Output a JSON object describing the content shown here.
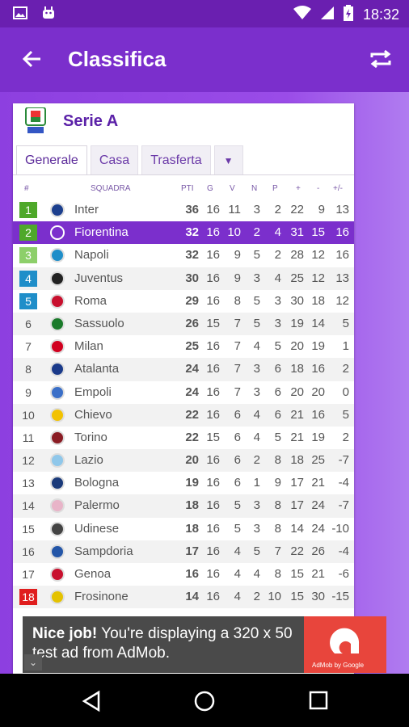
{
  "status": {
    "time": "18:32"
  },
  "appbar": {
    "title": "Classifica",
    "back_icon": "arrow-back-icon",
    "refresh_icon": "refresh-icon"
  },
  "card": {
    "league_name": "Serie A",
    "tabs": [
      "Generale",
      "Casa",
      "Trasferta"
    ],
    "dropdown": "▼"
  },
  "table": {
    "headers": {
      "pos": "#",
      "team": "SQUADRA",
      "pts": "PTI",
      "g": "G",
      "v": "V",
      "n": "N",
      "p": "P",
      "f": "+",
      "a": "-",
      "d": "+/-"
    },
    "rows": [
      {
        "pos": "1",
        "team": "Inter",
        "pts": "36",
        "g": "16",
        "v": "11",
        "n": "3",
        "p": "2",
        "f": "22",
        "a": "9",
        "d": "13"
      },
      {
        "pos": "2",
        "team": "Fiorentina",
        "pts": "32",
        "g": "16",
        "v": "10",
        "n": "2",
        "p": "4",
        "f": "31",
        "a": "15",
        "d": "16"
      },
      {
        "pos": "3",
        "team": "Napoli",
        "pts": "32",
        "g": "16",
        "v": "9",
        "n": "5",
        "p": "2",
        "f": "28",
        "a": "12",
        "d": "16"
      },
      {
        "pos": "4",
        "team": "Juventus",
        "pts": "30",
        "g": "16",
        "v": "9",
        "n": "3",
        "p": "4",
        "f": "25",
        "a": "12",
        "d": "13"
      },
      {
        "pos": "5",
        "team": "Roma",
        "pts": "29",
        "g": "16",
        "v": "8",
        "n": "5",
        "p": "3",
        "f": "30",
        "a": "18",
        "d": "12"
      },
      {
        "pos": "6",
        "team": "Sassuolo",
        "pts": "26",
        "g": "15",
        "v": "7",
        "n": "5",
        "p": "3",
        "f": "19",
        "a": "14",
        "d": "5"
      },
      {
        "pos": "7",
        "team": "Milan",
        "pts": "25",
        "g": "16",
        "v": "7",
        "n": "4",
        "p": "5",
        "f": "20",
        "a": "19",
        "d": "1"
      },
      {
        "pos": "8",
        "team": "Atalanta",
        "pts": "24",
        "g": "16",
        "v": "7",
        "n": "3",
        "p": "6",
        "f": "18",
        "a": "16",
        "d": "2"
      },
      {
        "pos": "9",
        "team": "Empoli",
        "pts": "24",
        "g": "16",
        "v": "7",
        "n": "3",
        "p": "6",
        "f": "20",
        "a": "20",
        "d": "0"
      },
      {
        "pos": "10",
        "team": "Chievo",
        "pts": "22",
        "g": "16",
        "v": "6",
        "n": "4",
        "p": "6",
        "f": "21",
        "a": "16",
        "d": "5"
      },
      {
        "pos": "11",
        "team": "Torino",
        "pts": "22",
        "g": "15",
        "v": "6",
        "n": "4",
        "p": "5",
        "f": "21",
        "a": "19",
        "d": "2"
      },
      {
        "pos": "12",
        "team": "Lazio",
        "pts": "20",
        "g": "16",
        "v": "6",
        "n": "2",
        "p": "8",
        "f": "18",
        "a": "25",
        "d": "-7"
      },
      {
        "pos": "13",
        "team": "Bologna",
        "pts": "19",
        "g": "16",
        "v": "6",
        "n": "1",
        "p": "9",
        "f": "17",
        "a": "21",
        "d": "-4"
      },
      {
        "pos": "14",
        "team": "Palermo",
        "pts": "18",
        "g": "16",
        "v": "5",
        "n": "3",
        "p": "8",
        "f": "17",
        "a": "24",
        "d": "-7"
      },
      {
        "pos": "15",
        "team": "Udinese",
        "pts": "18",
        "g": "16",
        "v": "5",
        "n": "3",
        "p": "8",
        "f": "14",
        "a": "24",
        "d": "-10"
      },
      {
        "pos": "16",
        "team": "Sampdoria",
        "pts": "17",
        "g": "16",
        "v": "4",
        "n": "5",
        "p": "7",
        "f": "22",
        "a": "26",
        "d": "-4"
      },
      {
        "pos": "17",
        "team": "Genoa",
        "pts": "16",
        "g": "16",
        "v": "4",
        "n": "4",
        "p": "8",
        "f": "15",
        "a": "21",
        "d": "-6"
      },
      {
        "pos": "18",
        "team": "Frosinone",
        "pts": "14",
        "g": "16",
        "v": "4",
        "n": "2",
        "p": "10",
        "f": "15",
        "a": "30",
        "d": "-15"
      }
    ]
  },
  "ad": {
    "bold": "Nice job!",
    "text": " You're displaying a 320 x 50 test ad from AdMob.",
    "brand": "AdMob by Google"
  },
  "colors": {
    "primary": "#7b2fcc",
    "status": "#6a1fb0",
    "green": "#4ea82a",
    "blue": "#1f8ec9",
    "red": "#e01e1e"
  }
}
